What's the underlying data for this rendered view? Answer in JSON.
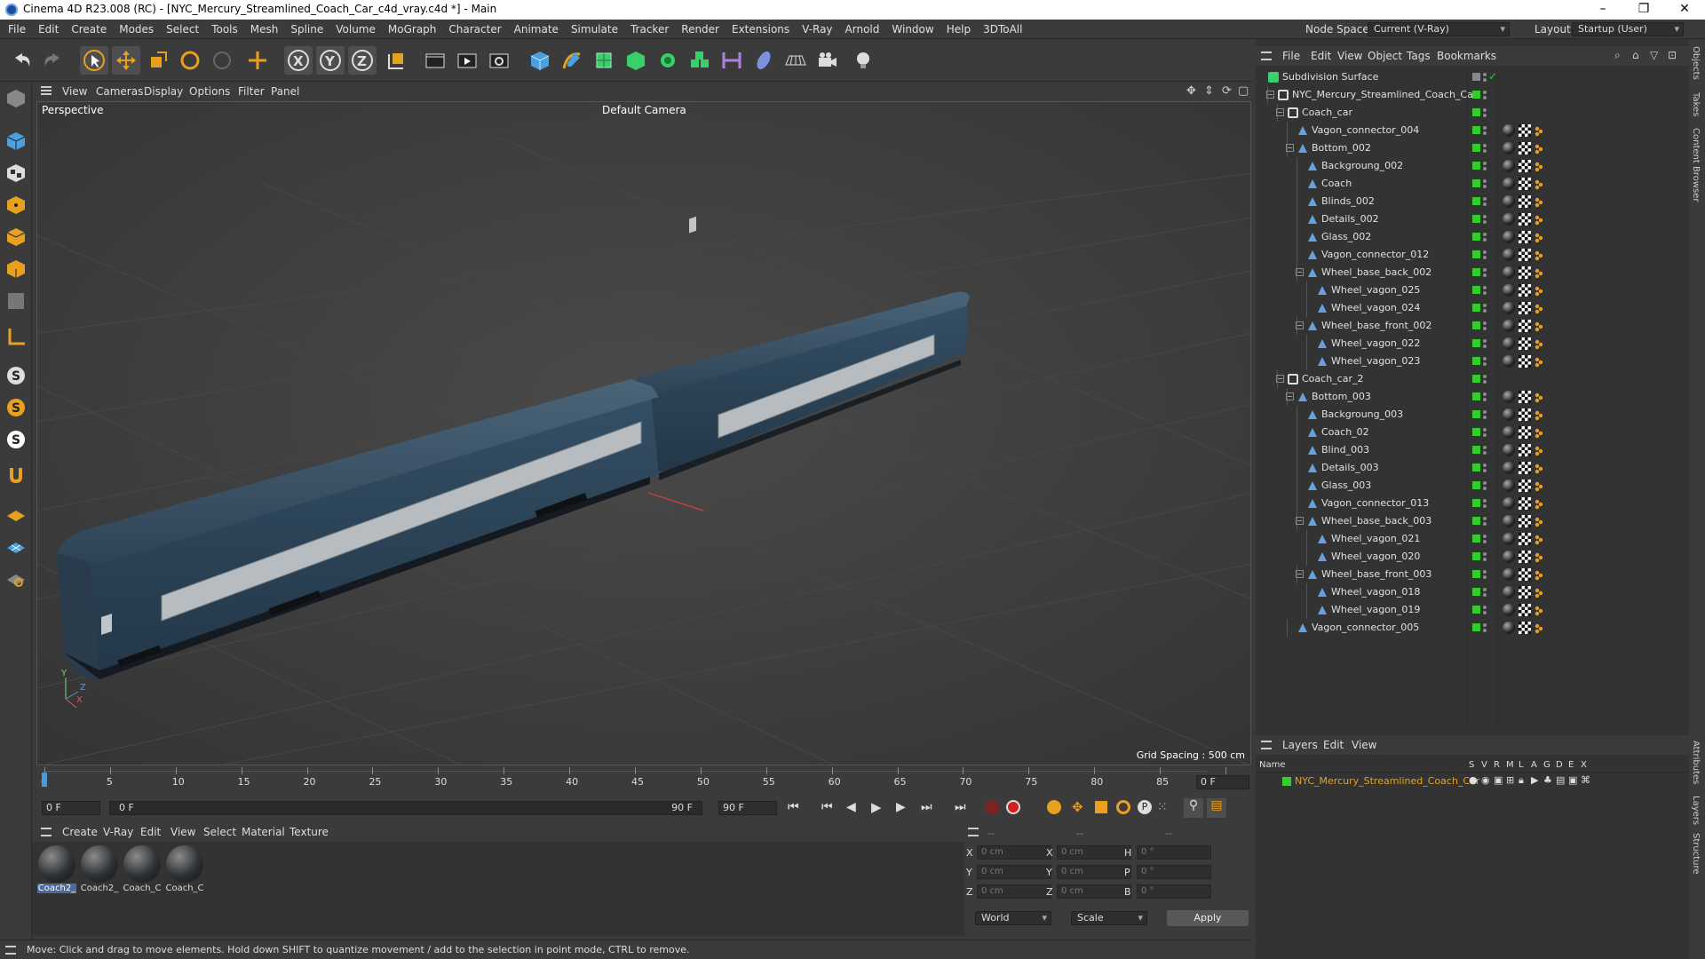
{
  "window": {
    "title": "Cinema 4D R23.008 (RC) - [NYC_Mercury_Streamlined_Coach_Car_c4d_vray.c4d *] - Main",
    "minimize": "–",
    "maximize": "❐",
    "close": "✕"
  },
  "menubar": {
    "items": [
      "File",
      "Edit",
      "Create",
      "Modes",
      "Select",
      "Tools",
      "Mesh",
      "Spline",
      "Volume",
      "MoGraph",
      "Character",
      "Animate",
      "Simulate",
      "Tracker",
      "Render",
      "Extensions",
      "V-Ray",
      "Arnold",
      "Window",
      "Help",
      "3DToAll"
    ],
    "node_space_label": "Node Space:",
    "node_space_value": "Current (V-Ray)",
    "layout_label": "Layout:",
    "layout_value": "Startup (User)"
  },
  "viewport": {
    "menu": [
      "View",
      "Cameras",
      "Display",
      "Options",
      "Filter",
      "Panel"
    ],
    "label": "Perspective",
    "camera": "Default Camera",
    "grid_spacing": "Grid Spacing : 500 cm",
    "axis_y": "Y",
    "axis_z": "Z",
    "axis_x": "X"
  },
  "timeline": {
    "ticks": [
      "0",
      "5",
      "10",
      "15",
      "20",
      "25",
      "30",
      "35",
      "40",
      "45",
      "50",
      "55",
      "60",
      "65",
      "70",
      "75",
      "80",
      "85",
      "90"
    ],
    "end_field": "0 F"
  },
  "transport": {
    "start": "0 F",
    "range_start": "0 F",
    "range_end": "90 F",
    "end": "90 F"
  },
  "materials": {
    "menu": [
      "Create",
      "V-Ray",
      "Edit",
      "View",
      "Select",
      "Material",
      "Texture"
    ],
    "items": [
      "Coach2_",
      "Coach2_",
      "Coach_C",
      "Coach_C"
    ]
  },
  "coords": {
    "header": [
      "--",
      "--",
      "--"
    ],
    "rows": [
      {
        "l1": "X",
        "v1": "0 cm",
        "l2": "X",
        "v2": "0 cm",
        "l3": "H",
        "v3": "0 °"
      },
      {
        "l1": "Y",
        "v1": "0 cm",
        "l2": "Y",
        "v2": "0 cm",
        "l3": "P",
        "v3": "0 °"
      },
      {
        "l1": "Z",
        "v1": "0 cm",
        "l2": "Z",
        "v2": "0 cm",
        "l3": "B",
        "v3": "0 °"
      }
    ],
    "world": "World",
    "scale": "Scale",
    "apply": "Apply"
  },
  "status": "Move: Click and drag to move elements. Hold down SHIFT to quantize movement / add to the selection in point mode, CTRL to remove.",
  "objects": {
    "menu": [
      "File",
      "Edit",
      "View",
      "Object",
      "Tags",
      "Bookmarks"
    ],
    "rows": [
      {
        "name": "Subdivision Surface",
        "depth": 0,
        "type": "subd",
        "tags": false
      },
      {
        "name": "NYC_Mercury_Streamlined_Coach_Car",
        "depth": 1,
        "type": "null",
        "tags": false
      },
      {
        "name": "Coach_car",
        "depth": 2,
        "type": "null",
        "tags": false
      },
      {
        "name": "Vagon_connector_004",
        "depth": 3,
        "type": "poly",
        "tags": true
      },
      {
        "name": "Bottom_002",
        "depth": 3,
        "type": "poly",
        "tags": true
      },
      {
        "name": "Backgroung_002",
        "depth": 4,
        "type": "poly",
        "tags": true
      },
      {
        "name": "Coach",
        "depth": 4,
        "type": "poly",
        "tags": true
      },
      {
        "name": "Blinds_002",
        "depth": 4,
        "type": "poly",
        "tags": true
      },
      {
        "name": "Details_002",
        "depth": 4,
        "type": "poly",
        "tags": true
      },
      {
        "name": "Glass_002",
        "depth": 4,
        "type": "poly",
        "tags": true
      },
      {
        "name": "Vagon_connector_012",
        "depth": 4,
        "type": "poly",
        "tags": true
      },
      {
        "name": "Wheel_base_back_002",
        "depth": 4,
        "type": "poly",
        "tags": true
      },
      {
        "name": "Wheel_vagon_025",
        "depth": 5,
        "type": "poly",
        "tags": true
      },
      {
        "name": "Wheel_vagon_024",
        "depth": 5,
        "type": "poly",
        "tags": true
      },
      {
        "name": "Wheel_base_front_002",
        "depth": 4,
        "type": "poly",
        "tags": true
      },
      {
        "name": "Wheel_vagon_022",
        "depth": 5,
        "type": "poly",
        "tags": true
      },
      {
        "name": "Wheel_vagon_023",
        "depth": 5,
        "type": "poly",
        "tags": true
      },
      {
        "name": "Coach_car_2",
        "depth": 2,
        "type": "null",
        "tags": false
      },
      {
        "name": "Bottom_003",
        "depth": 3,
        "type": "poly",
        "tags": true
      },
      {
        "name": "Backgroung_003",
        "depth": 4,
        "type": "poly",
        "tags": true
      },
      {
        "name": "Coach_02",
        "depth": 4,
        "type": "poly",
        "tags": true
      },
      {
        "name": "Blind_003",
        "depth": 4,
        "type": "poly",
        "tags": true
      },
      {
        "name": "Details_003",
        "depth": 4,
        "type": "poly",
        "tags": true
      },
      {
        "name": "Glass_003",
        "depth": 4,
        "type": "poly",
        "tags": true
      },
      {
        "name": "Vagon_connector_013",
        "depth": 4,
        "type": "poly",
        "tags": true
      },
      {
        "name": "Wheel_base_back_003",
        "depth": 4,
        "type": "poly",
        "tags": true
      },
      {
        "name": "Wheel_vagon_021",
        "depth": 5,
        "type": "poly",
        "tags": true
      },
      {
        "name": "Wheel_vagon_020",
        "depth": 5,
        "type": "poly",
        "tags": true
      },
      {
        "name": "Wheel_base_front_003",
        "depth": 4,
        "type": "poly",
        "tags": true
      },
      {
        "name": "Wheel_vagon_018",
        "depth": 5,
        "type": "poly",
        "tags": true
      },
      {
        "name": "Wheel_vagon_019",
        "depth": 5,
        "type": "poly",
        "tags": true
      },
      {
        "name": "Vagon_connector_005",
        "depth": 3,
        "type": "poly",
        "tags": true
      }
    ]
  },
  "layers": {
    "menu": [
      "Layers",
      "Edit",
      "View"
    ],
    "columns": [
      "Name",
      "S",
      "V",
      "R",
      "M",
      "L",
      "A",
      "G",
      "D",
      "E",
      "X"
    ],
    "layer_name": "NYC_Mercury_Streamlined_Coach_Car",
    "layer_color": "#33cc33"
  },
  "side_tabs": [
    "Objects",
    "Takes",
    "Content Browser",
    "Attributes",
    "Layers",
    "Structure"
  ],
  "colors": {
    "accent": "#4a6aa0",
    "green": "#33cc33",
    "orange": "#e8a020",
    "layer_text": "#e8a020"
  }
}
